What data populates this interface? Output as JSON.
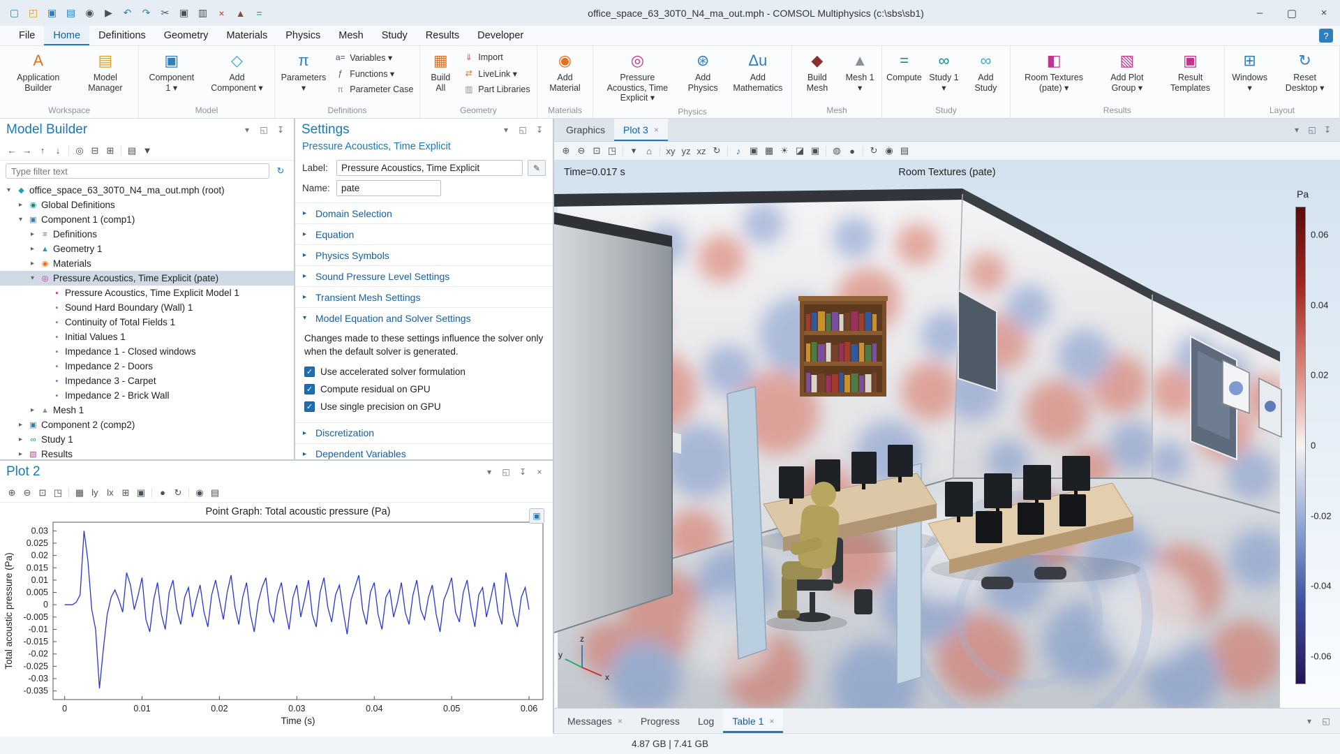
{
  "window": {
    "title": "office_space_63_30T0_N4_ma_out.mph - COMSOL Multiphysics (c:\\sbs\\sb1)",
    "quick_access": [
      "new-file",
      "open-file",
      "save",
      "save-copy",
      "snapshot",
      "play",
      "undo",
      "redo",
      "cut",
      "copy",
      "paste",
      "delete",
      "build-mesh",
      "compute"
    ]
  },
  "menubar": {
    "items": [
      {
        "label": "File"
      },
      {
        "label": "Home",
        "active": true
      },
      {
        "label": "Definitions"
      },
      {
        "label": "Geometry"
      },
      {
        "label": "Materials"
      },
      {
        "label": "Physics"
      },
      {
        "label": "Mesh"
      },
      {
        "label": "Study"
      },
      {
        "label": "Results"
      },
      {
        "label": "Developer"
      }
    ],
    "help_label": "?"
  },
  "ribbon": {
    "groups": [
      {
        "label": "Workspace",
        "items": [
          {
            "type": "large",
            "icon": "application-builder",
            "label": "Application Builder"
          },
          {
            "type": "large",
            "icon": "model-manager",
            "label": "Model Manager"
          }
        ]
      },
      {
        "label": "Model",
        "items": [
          {
            "type": "large",
            "icon": "component",
            "label": "Component 1",
            "dropdown": true
          },
          {
            "type": "large",
            "icon": "add-component",
            "label": "Add Component",
            "dropdown": true
          }
        ]
      },
      {
        "label": "Definitions",
        "items": [
          {
            "type": "large",
            "icon": "parameters",
            "label": "Parameters",
            "dropdown": true
          },
          {
            "type": "stack",
            "items": [
              {
                "icon": "variables",
                "label": "Variables",
                "dropdown": true
              },
              {
                "icon": "functions",
                "label": "Functions",
                "dropdown": true
              },
              {
                "icon": "parameter-case",
                "label": "Parameter Case"
              }
            ]
          }
        ]
      },
      {
        "label": "Geometry",
        "items": [
          {
            "type": "large",
            "icon": "build-all",
            "label": "Build All"
          },
          {
            "type": "stack",
            "items": [
              {
                "icon": "import",
                "label": "Import"
              },
              {
                "icon": "livelink",
                "label": "LiveLink",
                "dropdown": true
              },
              {
                "icon": "part-libraries",
                "label": "Part Libraries"
              }
            ]
          }
        ]
      },
      {
        "label": "Materials",
        "items": [
          {
            "type": "large",
            "icon": "add-material",
            "label": "Add Material"
          }
        ]
      },
      {
        "label": "Physics",
        "items": [
          {
            "type": "large",
            "icon": "pressure-acoustics",
            "label": "Pressure Acoustics, Time Explicit",
            "dropdown": true
          },
          {
            "type": "large",
            "icon": "add-physics",
            "label": "Add Physics"
          },
          {
            "type": "large",
            "icon": "add-mathematics",
            "label": "Add Mathematics"
          }
        ]
      },
      {
        "label": "Mesh",
        "items": [
          {
            "type": "large",
            "icon": "build-mesh",
            "label": "Build Mesh"
          },
          {
            "type": "large",
            "icon": "mesh",
            "label": "Mesh 1",
            "dropdown": true
          }
        ]
      },
      {
        "label": "Study",
        "items": [
          {
            "type": "large",
            "icon": "compute",
            "label": "Compute"
          },
          {
            "type": "large",
            "icon": "study",
            "label": "Study 1",
            "dropdown": true
          },
          {
            "type": "large",
            "icon": "add-study",
            "label": "Add Study"
          }
        ]
      },
      {
        "label": "Results",
        "items": [
          {
            "type": "large",
            "icon": "room-textures",
            "label": "Room Textures (pate)",
            "dropdown": true
          },
          {
            "type": "large",
            "icon": "add-plot-group",
            "label": "Add Plot Group",
            "dropdown": true
          },
          {
            "type": "large",
            "icon": "result-templates",
            "label": "Result Templates"
          }
        ]
      },
      {
        "label": "Layout",
        "items": [
          {
            "type": "large",
            "icon": "windows",
            "label": "Windows",
            "dropdown": true
          },
          {
            "type": "large",
            "icon": "reset-desktop",
            "label": "Reset Desktop",
            "dropdown": true
          }
        ]
      }
    ]
  },
  "model_builder": {
    "title": "Model Builder",
    "toolbar": [
      "navigate-back",
      "navigate-forward",
      "move-up",
      "move-down",
      "|",
      "show-toggle",
      "collapse-all",
      "expand-all",
      "|",
      "node-settings",
      "filter-nodes"
    ],
    "filter_placeholder": "Type filter text",
    "tree": [
      {
        "level": 0,
        "icon": "root",
        "label": "office_space_63_30T0_N4_ma_out.mph (root)",
        "expanded": true
      },
      {
        "level": 1,
        "icon": "global",
        "label": "Global Definitions",
        "expanded": false
      },
      {
        "level": 1,
        "icon": "component",
        "label": "Component 1 (comp1)",
        "expanded": true
      },
      {
        "level": 2,
        "icon": "definitions",
        "label": "Definitions",
        "expanded": false
      },
      {
        "level": 2,
        "icon": "geometry",
        "label": "Geometry 1",
        "expanded": false
      },
      {
        "level": 2,
        "icon": "materials",
        "label": "Materials",
        "expanded": false
      },
      {
        "level": 2,
        "icon": "physics",
        "label": "Pressure Acoustics, Time Explicit (pate)",
        "expanded": true,
        "selected": true
      },
      {
        "level": 3,
        "icon": "model-node",
        "label": "Pressure Acoustics, Time Explicit Model 1"
      },
      {
        "level": 3,
        "icon": "boundary",
        "label": "Sound Hard Boundary (Wall) 1"
      },
      {
        "level": 3,
        "icon": "boundary",
        "label": "Continuity of Total Fields 1"
      },
      {
        "level": 3,
        "icon": "initial",
        "label": "Initial Values 1"
      },
      {
        "level": 3,
        "icon": "boundary",
        "label": "Impedance 1 - Closed windows"
      },
      {
        "level": 3,
        "icon": "boundary",
        "label": "Impedance 2 - Doors"
      },
      {
        "level": 3,
        "icon": "boundary",
        "label": "Impedance 3 - Carpet"
      },
      {
        "level": 3,
        "icon": "boundary",
        "label": "Impedance 2 - Brick Wall"
      },
      {
        "level": 2,
        "icon": "mesh",
        "label": "Mesh 1",
        "expanded": false
      },
      {
        "level": 1,
        "icon": "component",
        "label": "Component 2 (comp2)",
        "expanded": false
      },
      {
        "level": 1,
        "icon": "study",
        "label": "Study 1",
        "expanded": false
      },
      {
        "level": 1,
        "icon": "results",
        "label": "Results",
        "expanded": false
      }
    ]
  },
  "settings": {
    "title": "Settings",
    "subtitle": "Pressure Acoustics, Time Explicit",
    "label_field": {
      "label": "Label:",
      "value": "Pressure Acoustics, Time Explicit"
    },
    "name_field": {
      "label": "Name:",
      "value": "pate"
    },
    "sections": [
      {
        "label": "Domain Selection",
        "expanded": false
      },
      {
        "label": "Equation",
        "expanded": false
      },
      {
        "label": "Physics Symbols",
        "expanded": false
      },
      {
        "label": "Sound Pressure Level Settings",
        "expanded": false
      },
      {
        "label": "Transient Mesh Settings",
        "expanded": false
      },
      {
        "label": "Model Equation and Solver Settings",
        "expanded": true,
        "description": "Changes made to these settings influence the solver only when the default solver is generated.",
        "checkboxes": [
          {
            "label": "Use accelerated solver formulation",
            "checked": true
          },
          {
            "label": "Compute residual on GPU",
            "checked": true
          },
          {
            "label": "Use single precision on GPU",
            "checked": true
          }
        ]
      },
      {
        "label": "Discretization",
        "expanded": false
      },
      {
        "label": "Dependent Variables",
        "expanded": false
      }
    ]
  },
  "plot2": {
    "title": "Plot 2",
    "toolbar": [
      "zoom-in",
      "zoom-out",
      "zoom-box",
      "zoom-extents",
      "|",
      "grid-lines",
      "y-log-scale",
      "x-log-scale",
      "axis-limits",
      "lock-axes",
      "|",
      "color-theme",
      "update-plot",
      "|",
      "image-snapshot",
      "print"
    ]
  },
  "chart_data": {
    "type": "line",
    "title": "Point Graph: Total acoustic pressure (Pa)",
    "xlabel": "Time (s)",
    "ylabel": "Total acoustic pressure (Pa)",
    "xlim": [
      0,
      0.06
    ],
    "ylim": [
      -0.035,
      0.03
    ],
    "x_ticks": [
      0,
      0.01,
      0.02,
      0.03,
      0.04,
      0.05,
      0.06
    ],
    "y_ticks": [
      0.03,
      0.025,
      0.02,
      0.015,
      0.01,
      0.005,
      0,
      -0.005,
      -0.01,
      -0.015,
      -0.02,
      -0.025,
      -0.03,
      -0.035
    ],
    "grid": false,
    "legend_position": "none",
    "x_start": 0,
    "dx": 0.0005,
    "series": [
      {
        "name": "Total acoustic pressure",
        "color": "#2936cc",
        "values": [
          0,
          0,
          0,
          0.001,
          0.004,
          0.03,
          0.018,
          -0.002,
          -0.01,
          -0.034,
          -0.018,
          -0.004,
          0.003,
          0.006,
          0.002,
          -0.003,
          0.013,
          0.008,
          -0.002,
          0.004,
          0.011,
          -0.006,
          -0.011,
          0.002,
          0.009,
          -0.004,
          -0.01,
          0.005,
          0.01,
          -0.002,
          -0.008,
          0.003,
          0.007,
          -0.005,
          0.002,
          0.008,
          -0.003,
          -0.009,
          0.004,
          0.01,
          0.002,
          -0.006,
          0.005,
          0.012,
          -0.001,
          -0.008,
          0.003,
          0.009,
          -0.004,
          -0.011,
          0.001,
          0.007,
          0.011,
          -0.003,
          -0.007,
          0.004,
          0.009,
          -0.002,
          -0.01,
          0.003,
          0.008,
          -0.005,
          0.002,
          0.01,
          -0.004,
          -0.009,
          0.005,
          0.011,
          -0.001,
          -0.007,
          0.004,
          0.008,
          -0.003,
          -0.012,
          0.002,
          0.007,
          0.012,
          -0.002,
          -0.008,
          0.005,
          0.009,
          -0.004,
          -0.01,
          0.003,
          0.006,
          -0.005,
          0.001,
          0.009,
          -0.003,
          -0.008,
          0.004,
          0.01,
          -0.002,
          -0.006,
          0.003,
          0.008,
          -0.004,
          -0.011,
          0.002,
          0.006,
          0.011,
          -0.003,
          -0.007,
          0.005,
          0.01,
          -0.001,
          -0.009,
          0.004,
          0.007,
          -0.005,
          0.002,
          0.009,
          -0.003,
          -0.008,
          0.013,
          0.005,
          -0.004,
          -0.009,
          0.003,
          0.007,
          -0.002
        ]
      }
    ]
  },
  "graphics": {
    "tabs": [
      {
        "label": "Graphics",
        "closable": false,
        "active": false
      },
      {
        "label": "Plot 3",
        "closable": true,
        "active": true
      }
    ],
    "toolbar": [
      "zoom-in",
      "zoom-out",
      "zoom-box",
      "zoom-extents",
      "|",
      "view-orientation",
      "go-to-default-view",
      "|",
      "go-to-xy-view",
      "go-to-yz-view",
      "go-to-xz-view",
      "rotate-view",
      "|",
      "play-sound",
      "copy-image",
      "show-grid",
      "scene-light",
      "transparency",
      "lock-view",
      "|",
      "environment",
      "color-theme",
      "|",
      "update-plot",
      "image-snapshot",
      "print"
    ],
    "time_label": "Time=0.017 s",
    "plot_title": "Room Textures (pate)",
    "legend": {
      "unit": "Pa",
      "max": 0.068,
      "min": -0.068,
      "ticks": [
        0.06,
        0.04,
        0.02,
        0,
        -0.02,
        -0.04,
        -0.06
      ],
      "colors": [
        "#5e0a0c",
        "#a32723",
        "#d98175",
        "#f6f3f2",
        "#8fa7d6",
        "#3c4ea0",
        "#251457"
      ]
    },
    "axes_triad": [
      "x",
      "y",
      "z"
    ]
  },
  "bottom_tabs": [
    {
      "label": "Messages",
      "closable": true,
      "active": false
    },
    {
      "label": "Progress",
      "closable": false,
      "active": false
    },
    {
      "label": "Log",
      "closable": false,
      "active": false
    },
    {
      "label": "Table 1",
      "closable": true,
      "active": true
    }
  ],
  "statusbar": {
    "memory": "4.87 GB | 7.41 GB"
  }
}
